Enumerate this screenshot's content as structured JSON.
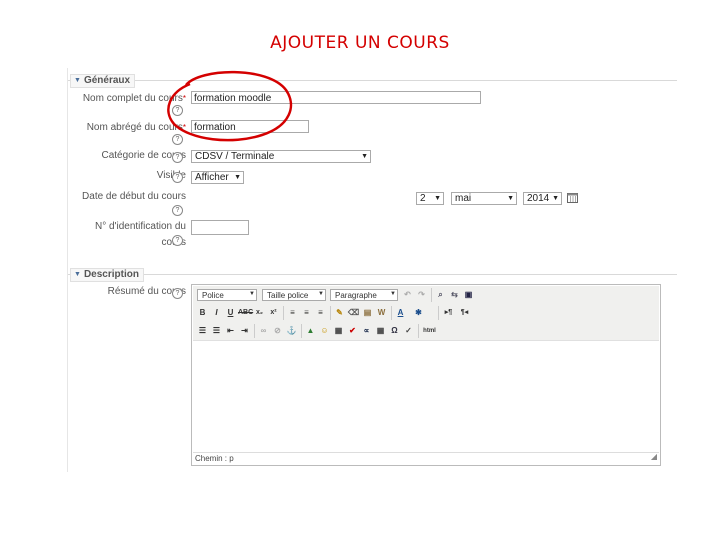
{
  "slide": {
    "title": "AJOUTER UN COURS",
    "annotation_color": "#d40000"
  },
  "general": {
    "header": "Généraux",
    "fields": {
      "fullname": {
        "label": "Nom complet du cours",
        "value": "formation moodle"
      },
      "shortname": {
        "label": "Nom abrégé du cours",
        "value": "formation"
      },
      "category": {
        "label": "Catégorie de cours",
        "value": "CDSV / Terminale"
      },
      "visible": {
        "label": "Visible",
        "value": "Afficher"
      },
      "startdate": {
        "label": "Date de début du cours",
        "day": "2",
        "month": "mai",
        "year": "2014"
      },
      "idnumber": {
        "label_line1": "N° d'identification du",
        "label_line2": "cours",
        "value": ""
      }
    }
  },
  "description": {
    "header": "Description",
    "summary_label": "Résumé du cours",
    "toolbar": {
      "font_family": "Police",
      "font_size": "Taille police",
      "format": "Paragraphe"
    },
    "status_path": "Chemin : p"
  },
  "icons": [
    "help-icon",
    "calendar-icon",
    "triangle-down-icon"
  ]
}
